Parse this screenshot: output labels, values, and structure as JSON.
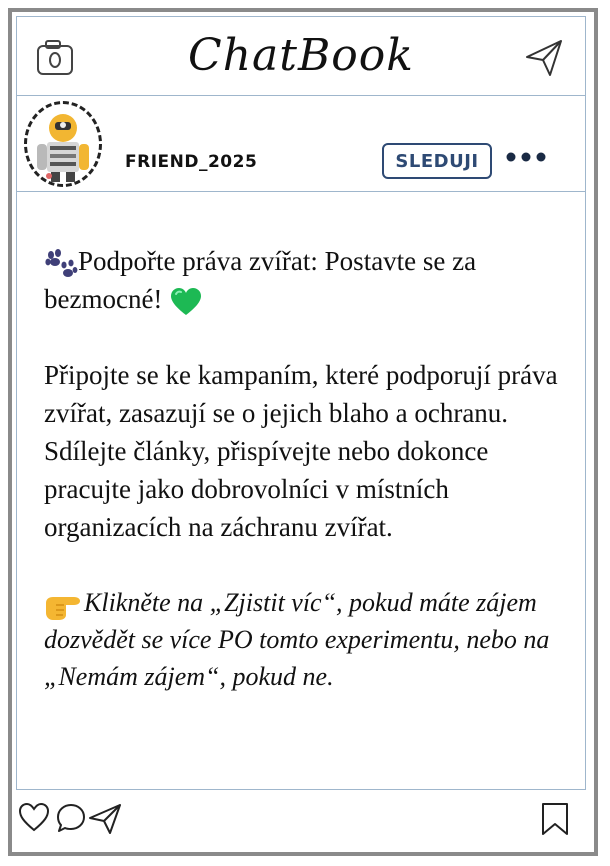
{
  "app": {
    "title": "ChatBook"
  },
  "profile": {
    "username": "FRIEND_2025",
    "follow_label": "SLEDUJI"
  },
  "post": {
    "headline": "Podpořte práva zvířat: Postavte se za bezmocné!",
    "body": "Připojte se ke kampaním, které podporují práva zvířat, zasazují se o jejich blaho a ochranu. Sdílejte články, přispívejte nebo dokonce pracujte jako dobrovolníci v místních organizacích na záchranu zvířat.",
    "cta": "Klikněte na „Zjistit víc“, pokud máte zájem dozvědět se více PO tomto experimentu, nebo na „Nemám zájem“, pokud ne."
  },
  "icons": {
    "top_left": "camera-icon",
    "top_right": "send-icon",
    "headline_lead": "paw-prints-icon",
    "headline_trail": "green-heart-icon",
    "cta_lead": "pointing-hand-icon",
    "footer": [
      "heart-icon",
      "comment-icon",
      "share-icon",
      "bookmark-icon"
    ]
  },
  "colors": {
    "follow": "#2e4a74",
    "heart": "#1db954",
    "frame": "#8a8a8a",
    "divider": "#9fb6cc"
  }
}
